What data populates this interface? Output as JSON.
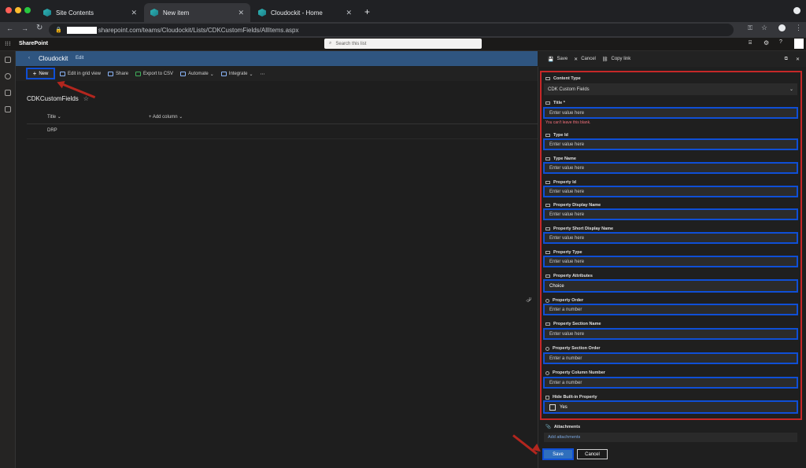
{
  "browser": {
    "tabs": [
      {
        "label": "Site Contents"
      },
      {
        "label": "New item"
      },
      {
        "label": "Cloudockit - Home"
      }
    ],
    "url": "sharepoint.com/teams/Cloudockit/Lists/CDKCustomFields/AllItems.aspx"
  },
  "suite": {
    "app_name": "SharePoint",
    "search_placeholder": "Search this list"
  },
  "site": {
    "name": "Cloudockit",
    "edit_label": "Edit"
  },
  "commandbar": {
    "new_label": "New",
    "items": [
      "Edit in grid view",
      "Share",
      "Export to CSV",
      "Automate",
      "Integrate"
    ]
  },
  "list": {
    "title": "CDKCustomFields",
    "columns": [
      "Title",
      "Add column"
    ],
    "rows": [
      "DRP"
    ]
  },
  "panel": {
    "save": "Save",
    "cancel": "Cancel",
    "copy_link": "Copy link",
    "content_type_label": "Content Type",
    "content_type_value": "CDK Custom Fields",
    "fields": [
      {
        "label": "Title *",
        "value": "Enter value here",
        "error": "You can't leave this blank."
      },
      {
        "label": "Type Id",
        "value": "Enter value here"
      },
      {
        "label": "Type Name",
        "value": "Enter value here"
      },
      {
        "label": "Property Id",
        "value": "Enter value here"
      },
      {
        "label": "Property Display Name",
        "value": "Enter value here"
      },
      {
        "label": "Property Short Display Name",
        "value": "Enter value here"
      },
      {
        "label": "Property Type",
        "value": "Enter value here"
      },
      {
        "label": "Property Attributes",
        "value": "Choice"
      },
      {
        "label": "Property Order",
        "value": "Enter a number"
      },
      {
        "label": "Property Section Name",
        "value": "Enter value here"
      },
      {
        "label": "Property Section Order",
        "value": "Enter a number"
      },
      {
        "label": "Property Column Number",
        "value": "Enter a number"
      }
    ],
    "checkbox_field": {
      "label": "Hide Built-in Property",
      "option": "Yes"
    },
    "attachments_label": "Attachments",
    "attachments_link": "Add attachments",
    "save_button": "Save",
    "cancel_button": "Cancel"
  },
  "colors": {
    "accent": "#0f4fd6",
    "highlight": "#c62828",
    "site_bar": "#2f5580"
  }
}
